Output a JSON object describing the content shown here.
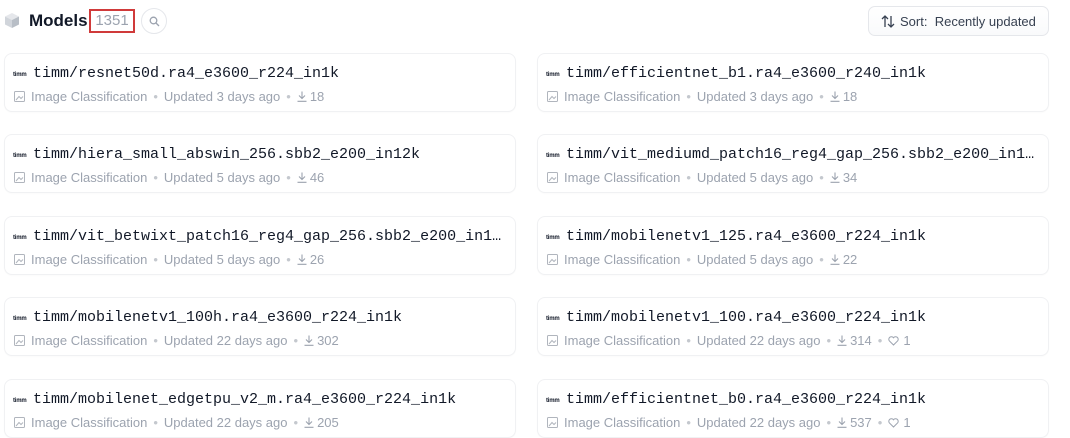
{
  "header": {
    "title": "Models",
    "count": "1351",
    "sort_label": "Sort:",
    "sort_value": "Recently updated"
  },
  "models": [
    {
      "logo": "timm",
      "name": "timm/resnet50d.ra4_e3600_r224_in1k",
      "task": "Image Classification",
      "updated": "Updated 3 days ago",
      "downloads": "18",
      "likes": ""
    },
    {
      "logo": "timm",
      "name": "timm/efficientnet_b1.ra4_e3600_r240_in1k",
      "task": "Image Classification",
      "updated": "Updated 3 days ago",
      "downloads": "18",
      "likes": ""
    },
    {
      "logo": "timm",
      "name": "timm/hiera_small_abswin_256.sbb2_e200_in12k",
      "task": "Image Classification",
      "updated": "Updated 5 days ago",
      "downloads": "46",
      "likes": ""
    },
    {
      "logo": "timm",
      "name": "timm/vit_mediumd_patch16_reg4_gap_256.sbb2_e200_in1…",
      "task": "Image Classification",
      "updated": "Updated 5 days ago",
      "downloads": "34",
      "likes": ""
    },
    {
      "logo": "timm",
      "name": "timm/vit_betwixt_patch16_reg4_gap_256.sbb2_e200_in1…",
      "task": "Image Classification",
      "updated": "Updated 5 days ago",
      "downloads": "26",
      "likes": ""
    },
    {
      "logo": "timm",
      "name": "timm/mobilenetv1_125.ra4_e3600_r224_in1k",
      "task": "Image Classification",
      "updated": "Updated 5 days ago",
      "downloads": "22",
      "likes": ""
    },
    {
      "logo": "timm",
      "name": "timm/mobilenetv1_100h.ra4_e3600_r224_in1k",
      "task": "Image Classification",
      "updated": "Updated 22 days ago",
      "downloads": "302",
      "likes": ""
    },
    {
      "logo": "timm",
      "name": "timm/mobilenetv1_100.ra4_e3600_r224_in1k",
      "task": "Image Classification",
      "updated": "Updated 22 days ago",
      "downloads": "314",
      "likes": "1"
    },
    {
      "logo": "timm",
      "name": "timm/mobilenet_edgetpu_v2_m.ra4_e3600_r224_in1k",
      "task": "Image Classification",
      "updated": "Updated 22 days ago",
      "downloads": "205",
      "likes": ""
    },
    {
      "logo": "timm",
      "name": "timm/efficientnet_b0.ra4_e3600_r224_in1k",
      "task": "Image Classification",
      "updated": "Updated 22 days ago",
      "downloads": "537",
      "likes": "1"
    }
  ],
  "icons": [
    "cube-icon",
    "search-icon",
    "sort-arrows-icon",
    "image-classification-icon",
    "download-icon",
    "heart-icon"
  ],
  "colors": {
    "highlight_box": "#d03a3a",
    "muted_text": "#9ca3af",
    "border": "#e5e7eb"
  }
}
